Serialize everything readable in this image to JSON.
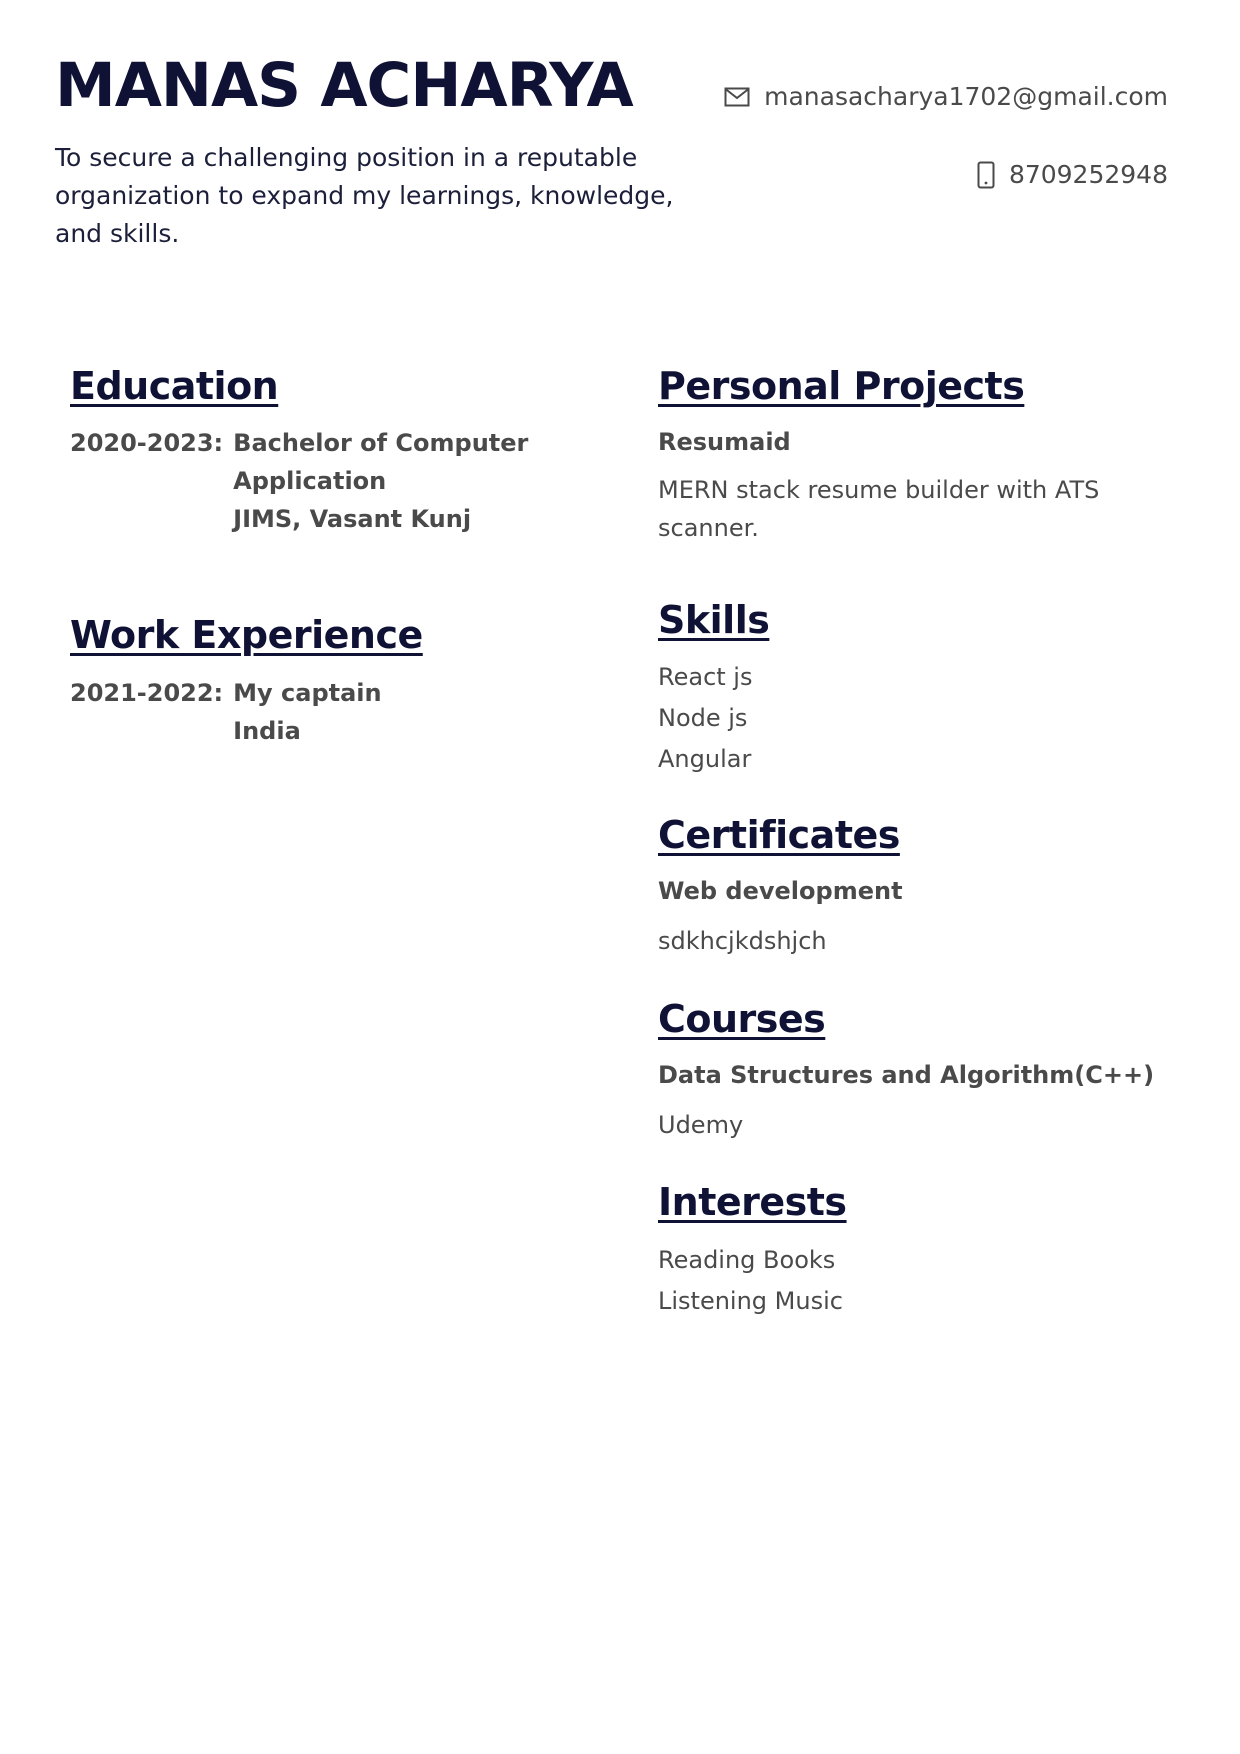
{
  "header": {
    "name": "MANAS ACHARYA",
    "objective": "To secure a challenging position in a reputable organization to expand my learnings, knowledge, and skills.",
    "email": "manasacharya1702@gmail.com",
    "phone": "8709252948",
    "email_icon": "mail-icon",
    "phone_icon": "mobile-phone-icon"
  },
  "education": {
    "heading": "Education",
    "date": "2020-2023:",
    "lines": [
      "Bachelor of Computer",
      "Application",
      "JIMS, Vasant Kunj"
    ]
  },
  "work": {
    "heading": "Work Experience",
    "date": "2021-2022:",
    "lines": [
      "My captain",
      "India"
    ]
  },
  "projects": {
    "heading": "Personal Projects",
    "title": "Resumaid",
    "description": "MERN stack resume builder with ATS scanner."
  },
  "skills": {
    "heading": "Skills",
    "items": [
      "React js",
      "Node js",
      "Angular"
    ]
  },
  "certificates": {
    "heading": "Certificates",
    "title": "Web development",
    "detail": "sdkhcjkdshjch"
  },
  "courses": {
    "heading": "Courses",
    "title": "Data Structures and Algorithm(C++)",
    "detail": "Udemy"
  },
  "interests": {
    "heading": "Interests",
    "items": [
      "Reading Books",
      "Listening Music"
    ]
  },
  "colors": {
    "heading": "#0f1235",
    "body_text": "#4a4a4a"
  }
}
